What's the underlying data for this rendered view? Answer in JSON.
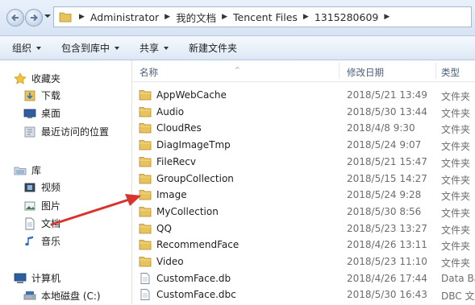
{
  "address": {
    "crumbs": [
      "Administrator",
      "我的文档",
      "Tencent Files",
      "1315280609"
    ]
  },
  "toolbar": {
    "organize": "组织",
    "include_in_library": "包含到库中",
    "share": "共享",
    "new_folder": "新建文件夹"
  },
  "nav": {
    "favorites": "收藏夹",
    "downloads": "下载",
    "desktop": "桌面",
    "recent": "最近访问的位置",
    "libraries": "库",
    "videos": "视频",
    "pictures": "图片",
    "documents": "文档",
    "music": "音乐",
    "computer": "计算机",
    "local_disk": "本地磁盘 (C:)"
  },
  "columns": {
    "name": "名称",
    "modified": "修改日期",
    "type": "类型"
  },
  "files": [
    {
      "name": "AppWebCache",
      "date": "2018/5/21 13:49",
      "type": "文件夹",
      "kind": "folder"
    },
    {
      "name": "Audio",
      "date": "2018/5/30 13:44",
      "type": "文件夹",
      "kind": "folder"
    },
    {
      "name": "CloudRes",
      "date": "2018/4/8 9:30",
      "type": "文件夹",
      "kind": "folder"
    },
    {
      "name": "DiagImageTmp",
      "date": "2018/5/24 9:07",
      "type": "文件夹",
      "kind": "folder"
    },
    {
      "name": "FileRecv",
      "date": "2018/5/21 15:47",
      "type": "文件夹",
      "kind": "folder"
    },
    {
      "name": "GroupCollection",
      "date": "2018/5/15 14:27",
      "type": "文件夹",
      "kind": "folder"
    },
    {
      "name": "Image",
      "date": "2018/5/24 9:28",
      "type": "文件夹",
      "kind": "folder"
    },
    {
      "name": "MyCollection",
      "date": "2018/5/30 8:56",
      "type": "文件夹",
      "kind": "folder"
    },
    {
      "name": "QQ",
      "date": "2018/5/23 13:27",
      "type": "文件夹",
      "kind": "folder"
    },
    {
      "name": "RecommendFace",
      "date": "2018/4/26 13:11",
      "type": "文件夹",
      "kind": "folder"
    },
    {
      "name": "Video",
      "date": "2018/5/23 11:10",
      "type": "文件夹",
      "kind": "folder"
    },
    {
      "name": "CustomFace.db",
      "date": "2018/4/26 17:44",
      "type": "Data Ba",
      "kind": "file"
    },
    {
      "name": "CustomFace.dbc",
      "date": "2018/5/30 16:43",
      "type": "DBC 文件",
      "kind": "file"
    }
  ],
  "colors": {
    "annotation_arrow": "#d9342b",
    "folder": "#e8c25a"
  }
}
